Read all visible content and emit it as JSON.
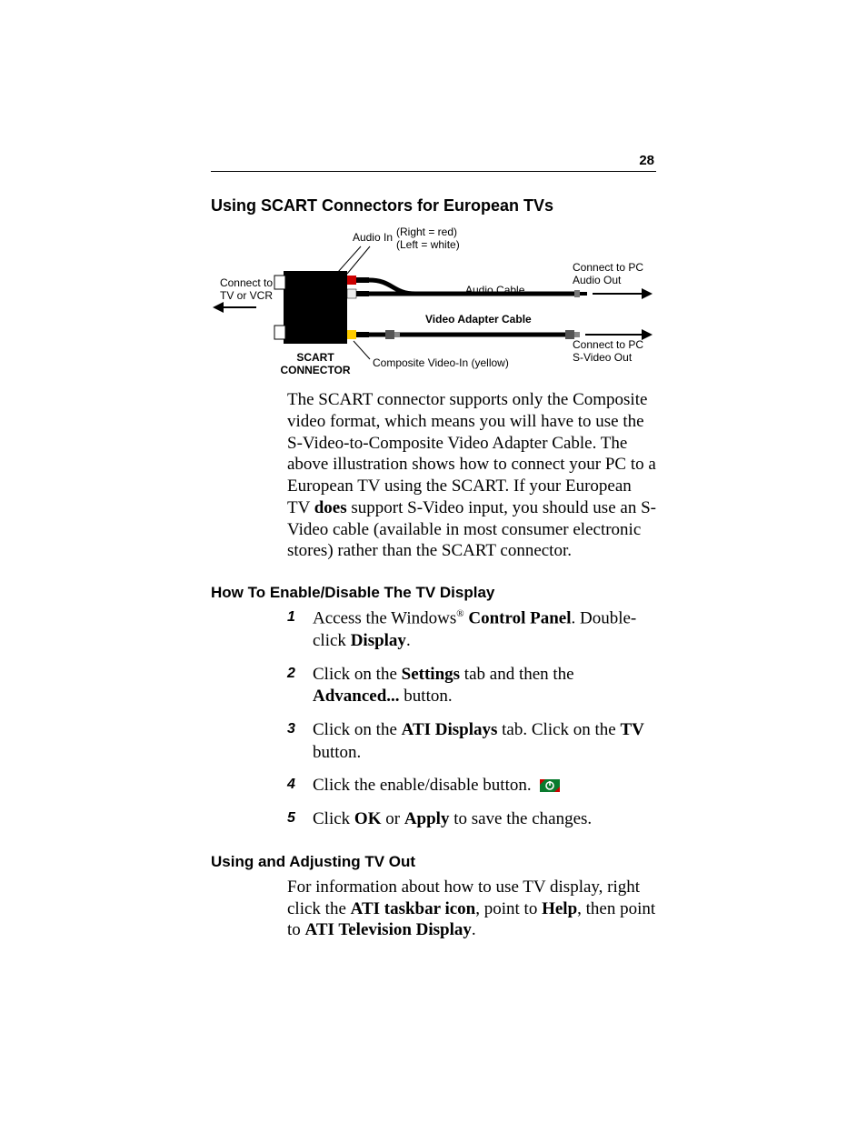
{
  "page_number": "28",
  "heading_scart": "Using SCART Connectors for European TVs",
  "diagram": {
    "audio_in": "Audio In",
    "right_red": "(Right = red)",
    "left_white": "(Left = white)",
    "connect_tv_vcr": "Connect to\nTV or VCR",
    "audio_cable": "Audio Cable",
    "connect_pc_audio": "Connect to PC\nAudio Out",
    "video_adapter_cable": "Video Adapter Cable",
    "connect_pc_svideo": "Connect to PC\nS-Video Out",
    "scart_connector": "SCART\nCONNECTOR",
    "composite_yellow": "Composite Video-In (yellow)"
  },
  "scart_para_1": "The SCART connector supports only the Composite video format, which means you will have to use the S-Video-to-Composite Video Adapter Cable. The above illustration shows how to connect your PC to a European TV using the SCART. If your European TV ",
  "scart_bold_does": "does",
  "scart_para_2": " support S-Video input, you should use an S-Video cable (available in most consumer electronic stores) rather than the SCART connector.",
  "heading_enable": "How To Enable/Disable The TV Display",
  "steps": {
    "s1a": "Access the Windows",
    "s1b": "Control Panel",
    "s1c": ". Double-click ",
    "s1d": "Display",
    "s1e": ".",
    "s2a": "Click on the ",
    "s2b": "Settings",
    "s2c": " tab and then the ",
    "s2d": "Advanced...",
    "s2e": " button.",
    "s3a": "Click on the ",
    "s3b": "ATI Displays",
    "s3c": " tab. Click on the ",
    "s3d": "TV",
    "s3e": " button.",
    "s4a": "Click the enable/disable button.",
    "s5a": "Click ",
    "s5b": "OK",
    "s5c": " or ",
    "s5d": "Apply",
    "s5e": " to save the changes."
  },
  "heading_adjust": "Using and Adjusting TV Out",
  "adjust_a": "For information about how to use TV display, right click the ",
  "adjust_b": "ATI taskbar icon",
  "adjust_c": ", point to ",
  "adjust_d": "Help",
  "adjust_e": ", then point to ",
  "adjust_f": "ATI Television Display",
  "adjust_g": "."
}
